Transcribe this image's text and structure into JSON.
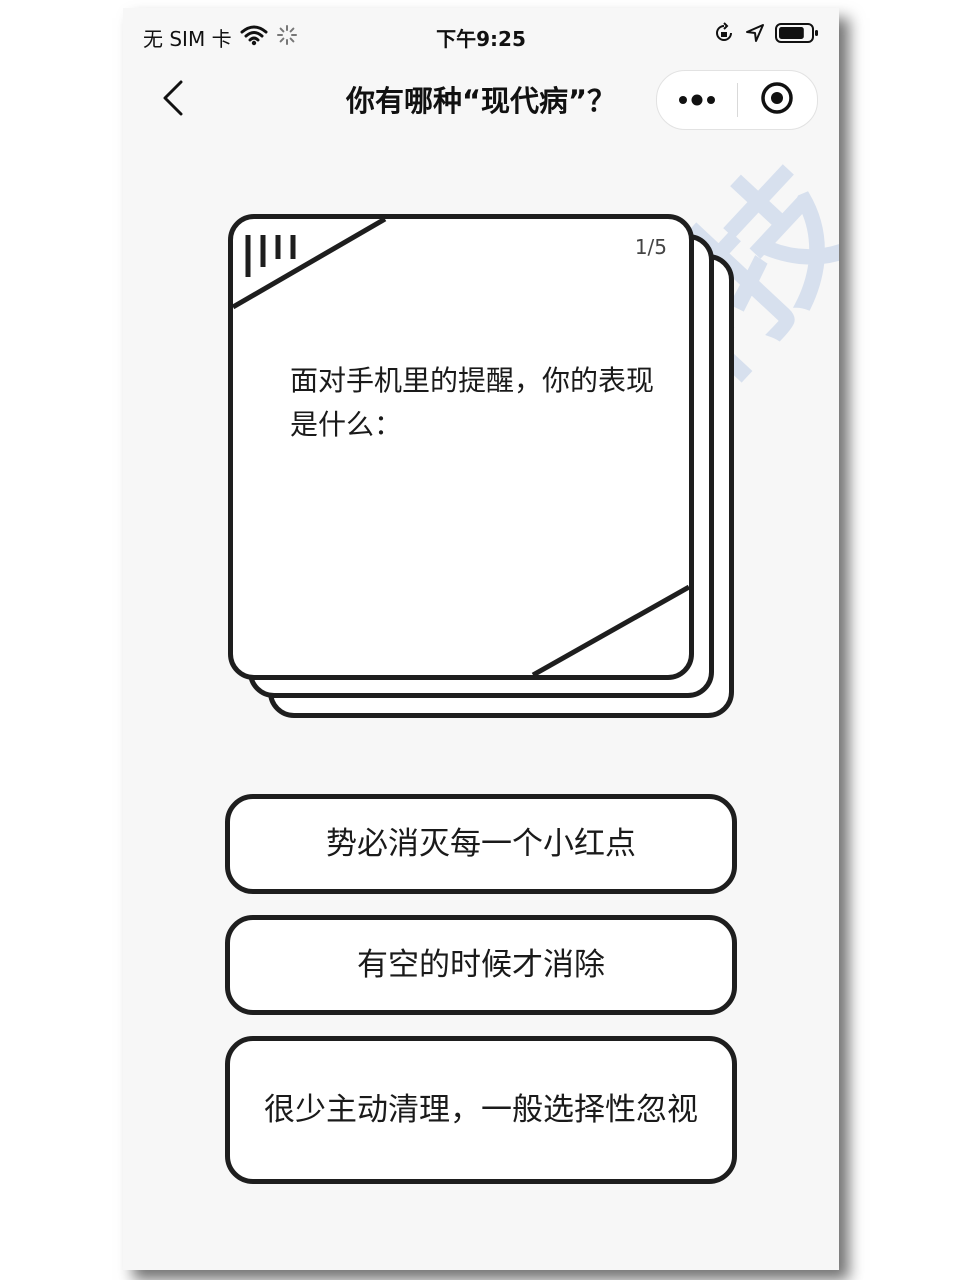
{
  "status_bar": {
    "carrier": "无 SIM 卡",
    "time": "下午9:25",
    "battery_level": 0.8
  },
  "nav": {
    "title": "你有哪种“现代病”？"
  },
  "watermark": {
    "text": "慧云科技"
  },
  "card": {
    "progress": "1/5",
    "question": "面对手机里的提醒，你的表现是什么："
  },
  "options": [
    {
      "label": "势必消灭每一个小红点"
    },
    {
      "label": "有空的时候才消除"
    },
    {
      "label": "很少主动清理，一般选择性忽视"
    }
  ],
  "colors": {
    "stroke": "#1e1e1e",
    "background": "#f7f7f7",
    "watermark": "#becde8"
  },
  "icons": [
    "wifi-icon",
    "loading-icon",
    "rotation-lock-icon",
    "location-arrow-icon",
    "battery-icon",
    "back-chevron-icon",
    "more-dots-icon",
    "target-icon"
  ]
}
